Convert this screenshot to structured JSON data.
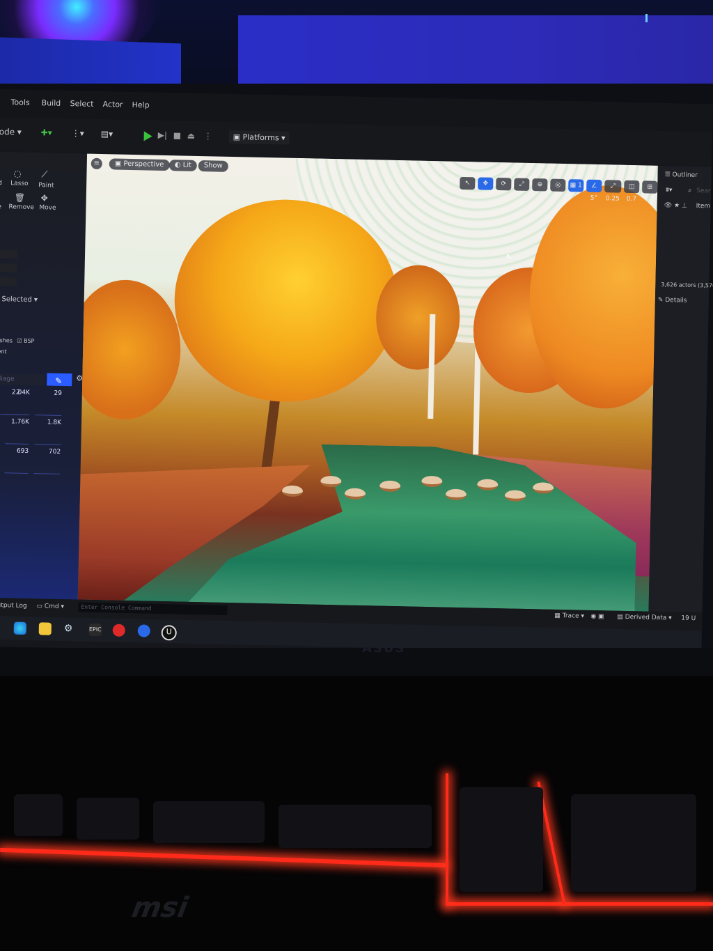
{
  "menubar": {
    "items": [
      "Tools",
      "Build",
      "Select",
      "Actor",
      "Help"
    ]
  },
  "toolbar": {
    "mode_label": "ode",
    "platforms_label": "Platforms"
  },
  "left_panel": {
    "tools": [
      "Lasso",
      "Paint",
      "Remove",
      "Move"
    ],
    "left_cut_labels": [
      "d",
      "e"
    ],
    "selection_label": "ll Selected",
    "filters": [
      "leshes",
      "BSP"
    ],
    "filter2": "cent",
    "search_placeholder": "oliage",
    "foliage_counts": [
      "2",
      "2.04K",
      "29",
      "K",
      "1.76K",
      "1.8K",
      "2",
      "693",
      "702"
    ]
  },
  "viewport": {
    "perspective_label": "Perspective",
    "lit_label": "Lit",
    "show_label": "Show",
    "angle_value": "5°",
    "scale_value": "0.25",
    "camera_value": "0.7",
    "layer_value": "1"
  },
  "right_panel": {
    "outliner_label": "Outliner",
    "search_hint": "Sear",
    "item_col": "Item",
    "actor_count": "3,626 actors (3,570",
    "details_label": "Details"
  },
  "statusbar": {
    "output_log": "Output Log",
    "cmd": "Cmd",
    "console_placeholder": "Enter Console Command",
    "trace": "Trace",
    "derived_data": "Derived Data",
    "right_cut": "19 U"
  },
  "monitor_brand": "ASUS",
  "keyboard_brand": "msi"
}
